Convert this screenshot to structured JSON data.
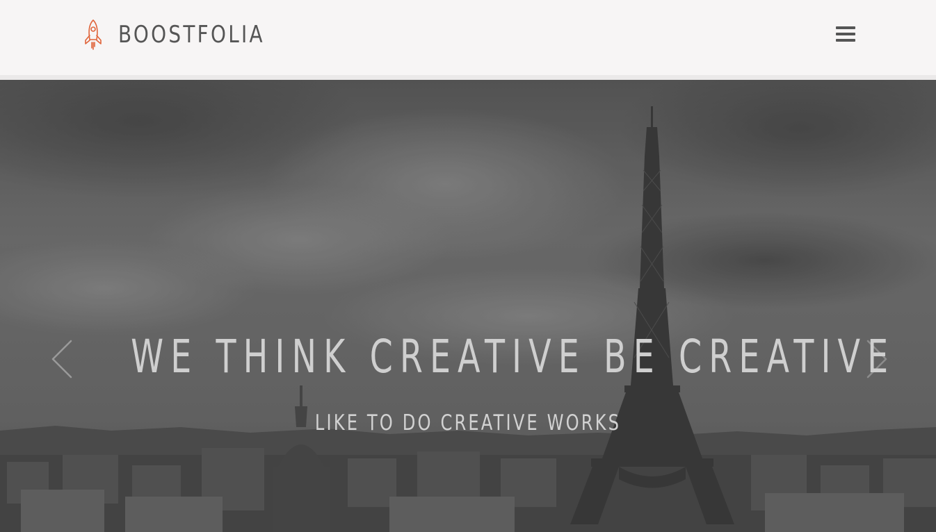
{
  "header": {
    "brand": "BOOSTFOLIA",
    "logo_icon": "rocket-icon",
    "menu_icon": "hamburger-menu-icon",
    "brand_color": "#555555",
    "logo_accent": "#e0643a"
  },
  "hero": {
    "title": "WE THINK CREATIVE BE CREATIVE",
    "subtitle": "LIKE TO DO CREATIVE WORKS",
    "background": "eiffel-tower-paris-grayscale-photo",
    "prev_icon": "chevron-left-icon",
    "next_icon": "chevron-right-icon"
  }
}
